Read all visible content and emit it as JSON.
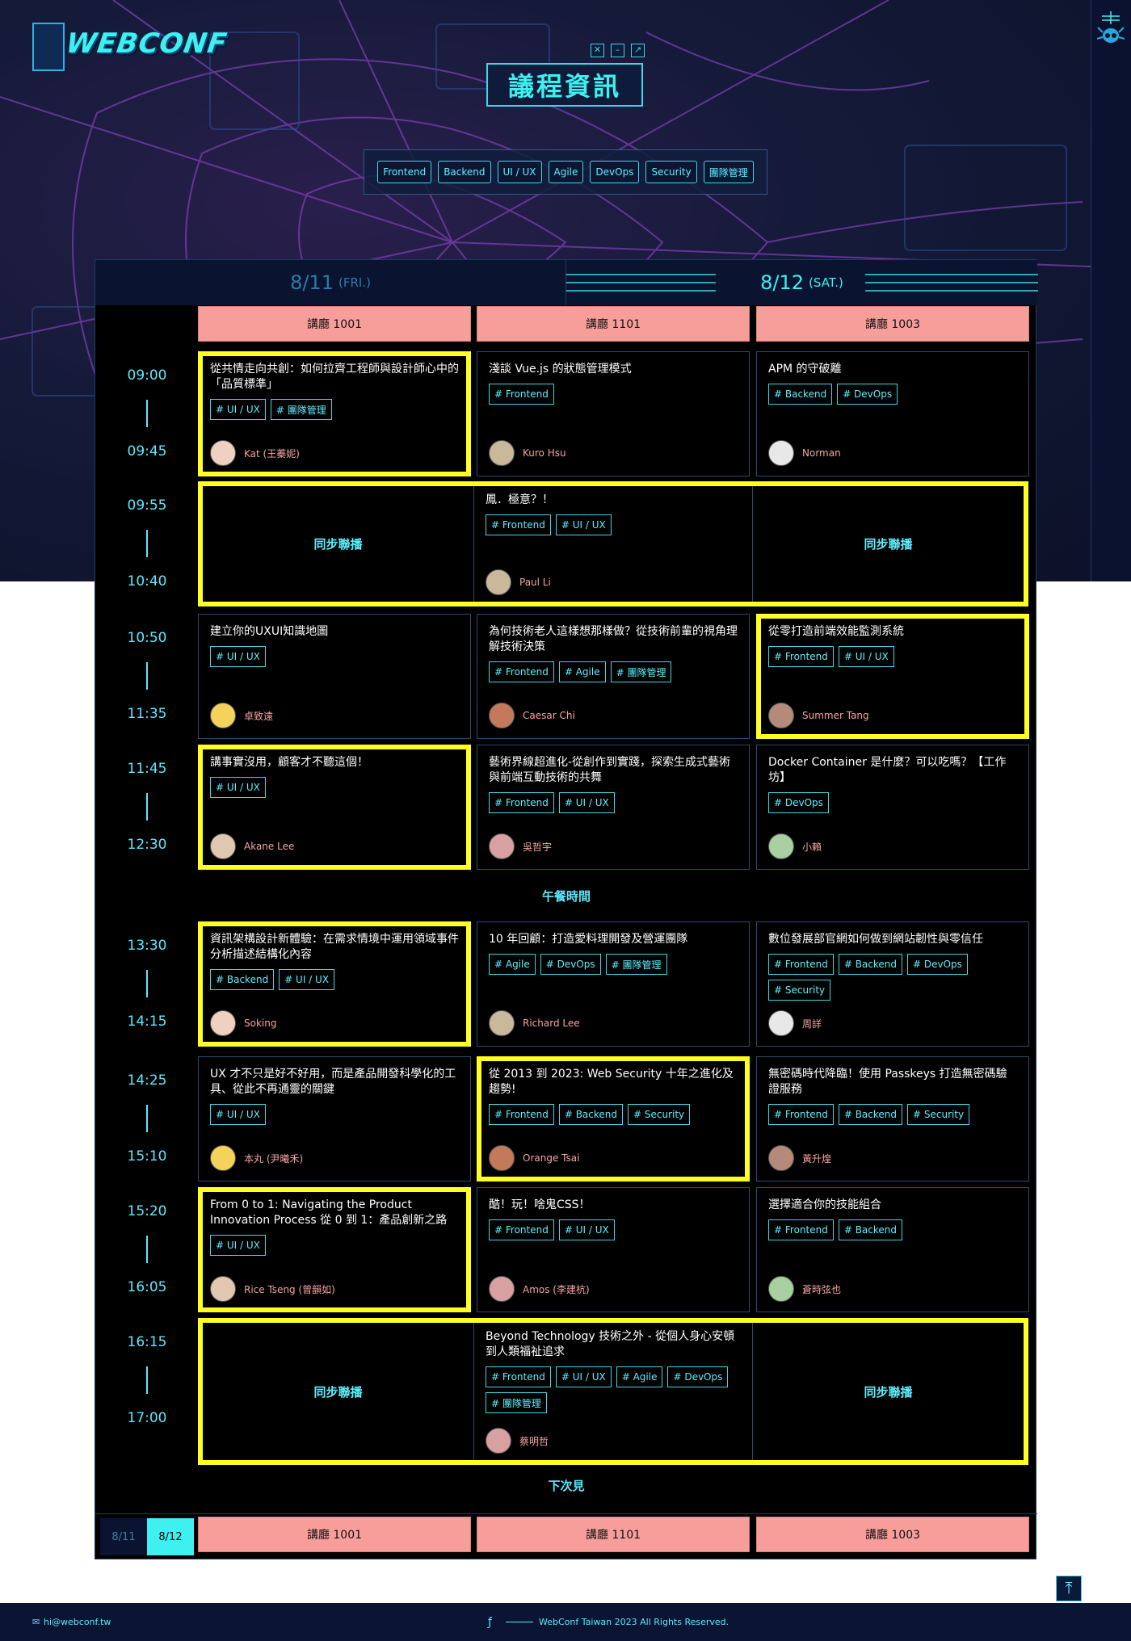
{
  "header": {
    "logo_text": "WEBCONF",
    "title": "議程資訊"
  },
  "filters": [
    "Frontend",
    "Backend",
    "UI / UX",
    "Agile",
    "DevOps",
    "Security",
    "團隊管理"
  ],
  "days": [
    {
      "date": "8/11",
      "weekday": "(FRI.)"
    },
    {
      "date": "8/12",
      "weekday": "(SAT.)"
    }
  ],
  "rooms": [
    "講廳 1001",
    "講廳 1101",
    "講廳 1003"
  ],
  "slots": [
    {
      "start": "09:00",
      "end": "09:45"
    },
    {
      "start": "09:55",
      "end": "10:40"
    },
    {
      "start": "10:50",
      "end": "11:35"
    },
    {
      "start": "11:45",
      "end": "12:30"
    },
    {
      "start": "13:30",
      "end": "14:15"
    },
    {
      "start": "14:25",
      "end": "15:10"
    },
    {
      "start": "15:20",
      "end": "16:05"
    },
    {
      "start": "16:15",
      "end": "17:00"
    }
  ],
  "sessions": [
    {
      "title": "從共情走向共創：如何拉齊工程師與設計師心中的「品質標準」",
      "tags": [
        "# UI / UX",
        "# 團隊管理"
      ],
      "speaker": "Kat (王蓁妮)",
      "highlight": true
    },
    {
      "title": "淺談 Vue.js 的狀態管理模式",
      "tags": [
        "# Frontend"
      ],
      "speaker": "Kuro Hsu",
      "highlight": false
    },
    {
      "title": "APM 的守破離",
      "tags": [
        "# Backend",
        "# DevOps"
      ],
      "speaker": "Norman",
      "highlight": false
    },
    {
      "title": "建立你的UXUI知識地圖",
      "tags": [
        "# UI / UX"
      ],
      "speaker": "卓致遠",
      "highlight": false
    },
    {
      "title": "為何技術老人這樣想那樣做？從技術前輩的視角理解技術決策",
      "tags": [
        "# Frontend",
        "# Agile",
        "# 團隊管理"
      ],
      "speaker": "Caesar Chi",
      "highlight": false
    },
    {
      "title": "從零打造前端效能監測系統",
      "tags": [
        "# Frontend",
        "# UI / UX"
      ],
      "speaker": "Summer Tang",
      "highlight": true
    },
    {
      "title": "講事實沒用，顧客才不聽這個！",
      "tags": [
        "# UI / UX"
      ],
      "speaker": "Akane Lee",
      "highlight": true
    },
    {
      "title": "藝術界線超進化-從創作到實踐，探索生成式藝術與前端互動技術的共舞",
      "tags": [
        "# Frontend",
        "# UI / UX"
      ],
      "speaker": "吳哲宇",
      "highlight": false
    },
    {
      "title": "Docker Container 是什麼？可以吃嗎？【工作坊】",
      "tags": [
        "# DevOps"
      ],
      "speaker": "小賴",
      "highlight": false
    },
    {
      "title": "資訊架構設計新體驗：在需求情境中運用領域事件分析描述結構化內容",
      "tags": [
        "# Backend",
        "# UI / UX"
      ],
      "speaker": "Soking",
      "highlight": true
    },
    {
      "title": "10 年回顧：打造愛料理開發及營運團隊",
      "tags": [
        "# Agile",
        "# DevOps",
        "# 團隊管理"
      ],
      "speaker": "Richard Lee",
      "highlight": false
    },
    {
      "title": "數位發展部官網如何做到網站韌性與零信任",
      "tags": [
        "# Frontend",
        "# Backend",
        "# DevOps",
        "# Security"
      ],
      "speaker": "周詳",
      "highlight": false
    },
    {
      "title": "UX 才不只是好不好用，而是產品開發科學化的工具、從此不再通靈的關鍵",
      "tags": [
        "# UI / UX"
      ],
      "speaker": "本丸 (尹曦禾)",
      "highlight": false
    },
    {
      "title": "從 2013 到 2023: Web Security 十年之進化及趨勢!",
      "tags": [
        "# Frontend",
        "# Backend",
        "# Security"
      ],
      "speaker": "Orange Tsai",
      "highlight": true
    },
    {
      "title": "無密碼時代降臨！使用 Passkeys 打造無密碼驗證服務",
      "tags": [
        "# Frontend",
        "# Backend",
        "# Security"
      ],
      "speaker": "黃升煌",
      "highlight": false
    },
    {
      "title": "From 0 to 1: Navigating the Product Innovation Process 從 0 到 1：產品創新之路",
      "tags": [
        "# UI / UX"
      ],
      "speaker": "Rice Tseng (曾韻如)",
      "highlight": true
    },
    {
      "title": "酷！玩！啥鬼CSS！",
      "tags": [
        "# Frontend",
        "# UI / UX"
      ],
      "speaker": "Amos (李建杭)",
      "highlight": false
    },
    {
      "title": "選擇適合你的技能組合",
      "tags": [
        "# Frontend",
        "# Backend"
      ],
      "speaker": "蒼時弦也",
      "highlight": false
    }
  ],
  "keynotes": [
    {
      "side": "同步聯播",
      "title": "鳳．極意？！",
      "tags": [
        "# Frontend",
        "# UI / UX"
      ],
      "speaker": "Paul Li"
    },
    {
      "side": "同步聯播",
      "title": "Beyond Technology 技術之外 - 從個人身心安頓到人類福祉追求",
      "tags": [
        "# Frontend",
        "# UI / UX",
        "# Agile",
        "# DevOps",
        "# 團隊管理"
      ],
      "speaker": "蔡明哲"
    }
  ],
  "lunch_label": "午餐時間",
  "end_label": "下次見",
  "bottom_tabs": [
    "8/11",
    "8/12"
  ],
  "footer": {
    "email": "hi@webconf.tw",
    "copyright": "WebConf Taiwan 2023 All Rights Reserved."
  },
  "colors": {
    "accent": "#3ef0f0",
    "room_bg": "#f79e9a",
    "highlight": "#ffff20",
    "speaker": "#f5a3a3"
  }
}
